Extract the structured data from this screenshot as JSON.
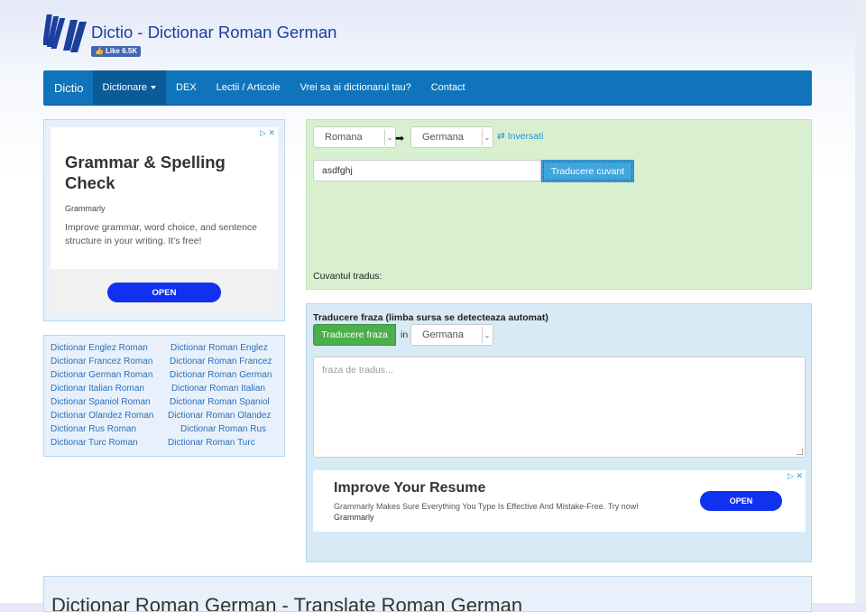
{
  "site": {
    "title": "Dictio - Dictionar Roman German",
    "fb_like": "Like 6.5K",
    "logo_icon": "books-logo-icon",
    "brand_color": "#1074ba"
  },
  "navbar": {
    "brand": "Dictio",
    "items": [
      {
        "label": "Dictionare",
        "dropdown": true,
        "active": true
      },
      {
        "label": "DEX"
      },
      {
        "label": "Lectii / Articole"
      },
      {
        "label": "Vrei sa ai dictionarul tau?"
      },
      {
        "label": "Contact"
      }
    ]
  },
  "left_ad": {
    "title": "Grammar & Spelling Check",
    "brand": "Grammarly",
    "description": "Improve grammar, word choice, and sentence structure in your writing. It's free!",
    "open_label": "OPEN",
    "ad_choices": "▷ ✕"
  },
  "dictionary_links": {
    "left": [
      "Dictionar Englez Roman",
      "Dictionar Francez Roman",
      "Dictionar German Roman",
      "Dictionar Italian Roman",
      "Dictionar Spaniol Roman",
      "Dictionar Olandez Roman",
      "Dictionar Rus Roman",
      "Dictionar Turc Roman"
    ],
    "right": [
      "Dictionar Roman Englez",
      "Dictionar Roman Francez",
      "Dictionar Roman German",
      "Dictionar Roman Italian",
      "Dictionar Roman Spaniol",
      "Dictionar Roman Olandez",
      "Dictionar Roman Rus",
      "Dictionar Roman Turc"
    ]
  },
  "word_translate": {
    "source_lang": "Romana",
    "target_lang": "Germana",
    "invert_label": "⇄ Inversati",
    "input_value": "asdfghj",
    "button_label": "Traducere cuvant",
    "result_label": "Cuvantul tradus:"
  },
  "phrase_translate": {
    "title": "Traducere fraza (limba sursa se detecteaza automat)",
    "button_label": "Traducere fraza",
    "in_label": "in",
    "target_lang": "Germana",
    "placeholder": "fraza de tradus..."
  },
  "bottom_ad": {
    "title": "Improve Your Resume",
    "description": "Grammarly Makes Sure Everything You Type Is Effective And Mistake-Free. Try now!",
    "brand": "Grammarly",
    "open_label": "OPEN",
    "ad_choices": "▷ ✕"
  },
  "bottom_section": {
    "heading": "Dictionar Roman German - Translate Roman German"
  }
}
